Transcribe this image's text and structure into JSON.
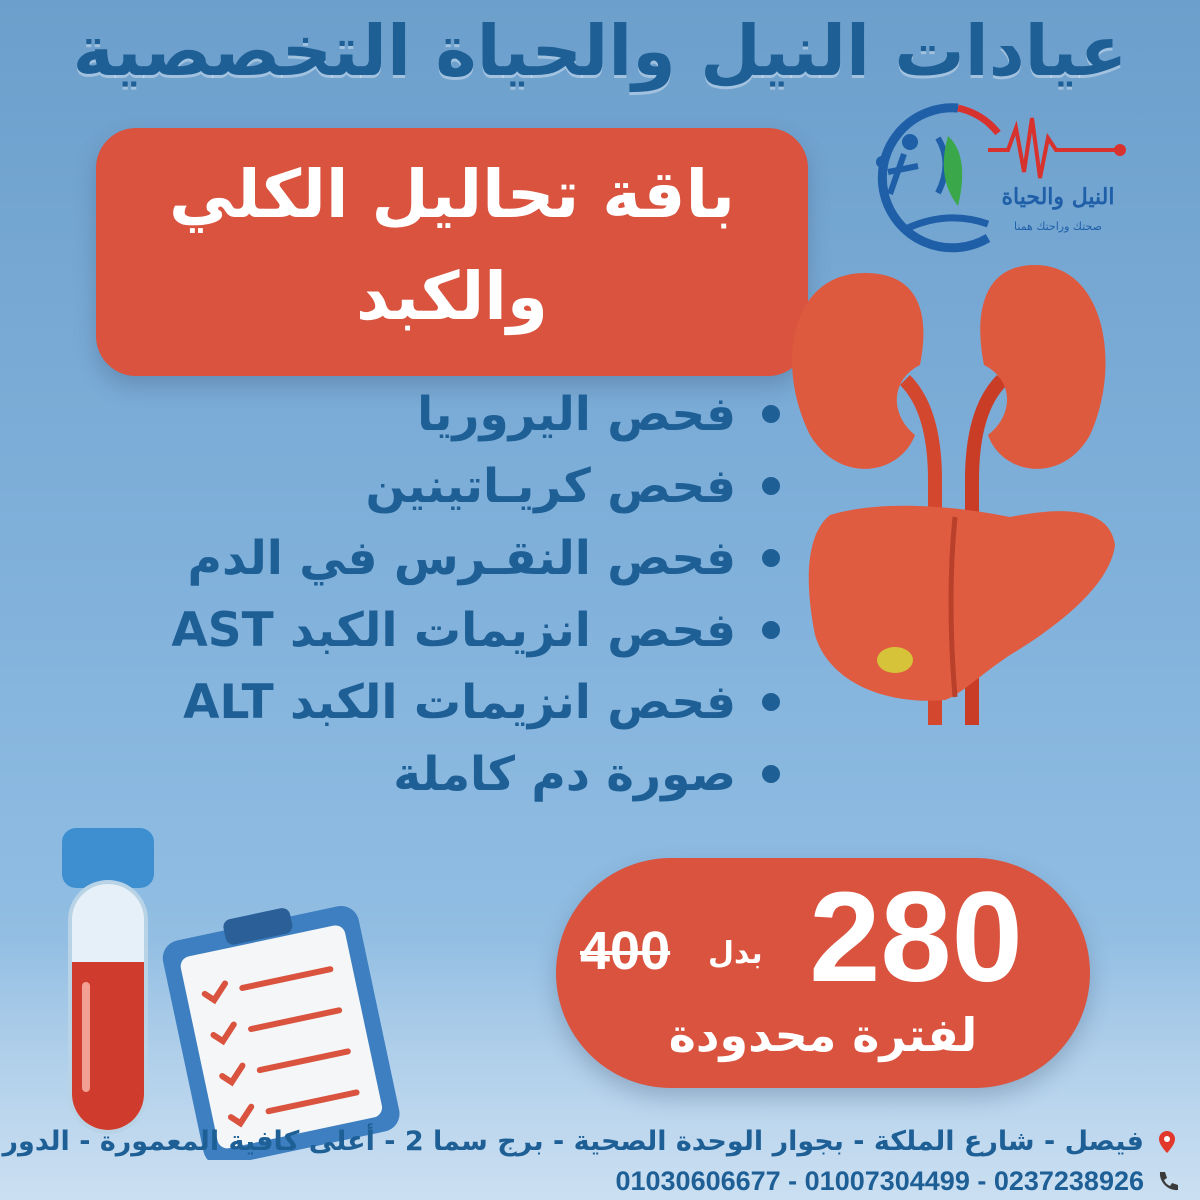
{
  "clinic_title": "عيادات النيل والحياة التخصصية",
  "logo": {
    "name": "النيل والحياة",
    "tagline": "صحتك وراحتك همنا",
    "colors": {
      "blue": "#1e5fa8",
      "red": "#d8322f",
      "green": "#3aa84a"
    }
  },
  "package": {
    "line1": "باقة تحاليل الكلي",
    "line2": "والكبد"
  },
  "tests": [
    "فحص اليروريا",
    "فحص كريـاتينين",
    "فحص النقـرس في الدم",
    "فحص انزيمات الكبد AST",
    "فحص انزيمات الكبد ALT",
    "صورة دم كاملة"
  ],
  "price": {
    "new": "280",
    "instead": "بدل",
    "old": "400",
    "limited": "لفترة محدودة"
  },
  "address": "فيصل - شارع الملكة - بجوار الوحدة الصحية - برج سما 2 - أعلى كافية المعمورة - الدور الأول",
  "phones": "01030606677 - 01007304499 - 0237238926",
  "icons": {
    "address": "location-pin-icon",
    "phone": "phone-icon"
  },
  "colors": {
    "accent_red": "#d9533f",
    "text_blue": "#1e5f96",
    "background": "#7fb0da"
  }
}
